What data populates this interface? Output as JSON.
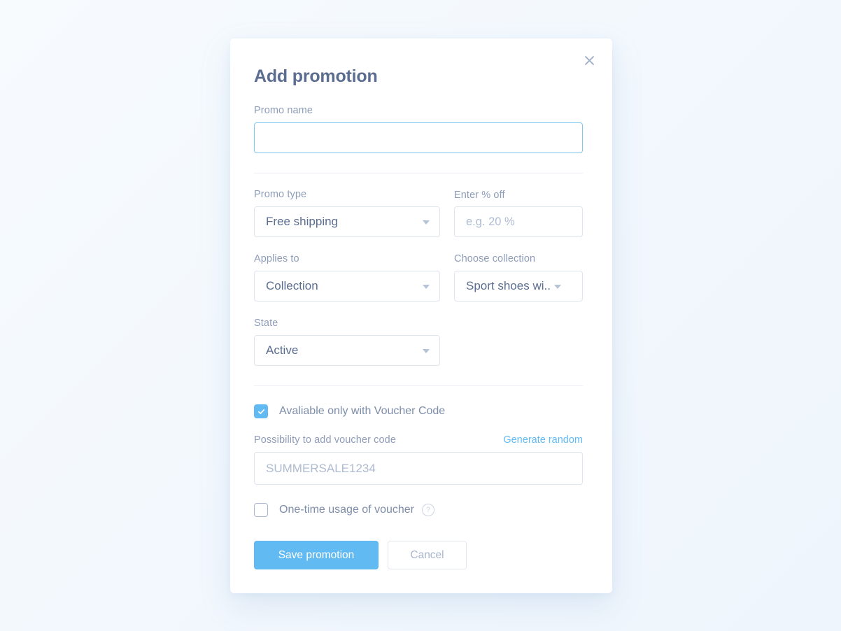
{
  "dialog": {
    "title": "Add promotion",
    "close_icon": "close-icon"
  },
  "fields": {
    "promo_name": {
      "label": "Promo name",
      "value": "",
      "placeholder": ""
    },
    "promo_type": {
      "label": "Promo type",
      "value": "Free shipping",
      "options": [
        "Free shipping"
      ]
    },
    "percent_off": {
      "label": "Enter % off",
      "value": "",
      "placeholder": "e.g. 20 %"
    },
    "applies_to": {
      "label": "Applies to",
      "value": "Collection",
      "options": [
        "Collection"
      ]
    },
    "choose_collection": {
      "label": "Choose collection",
      "value": "Sport shoes wi...",
      "options": [
        "Sport shoes wi..."
      ]
    },
    "state": {
      "label": "State",
      "value": "Active",
      "options": [
        "Active"
      ]
    }
  },
  "voucher": {
    "available_checkbox": {
      "label": "Avaliable only with Voucher Code",
      "checked": true
    },
    "code_label": "Possibility to add voucher code",
    "generate_link": "Generate random",
    "code_value": "",
    "code_placeholder": "SUMMERSALE1234",
    "one_time_checkbox": {
      "label": "One-time usage of voucher",
      "checked": false,
      "help_icon": "question-mark-icon",
      "help_glyph": "?"
    }
  },
  "actions": {
    "save_label": "Save promotion",
    "cancel_label": "Cancel"
  },
  "colors": {
    "accent": "#62baf3",
    "title": "#5b6d90",
    "label": "#8e9cb8",
    "page_background": "#f3f8fd",
    "card_background": "#ffffff",
    "border": "#dfe5ef",
    "focus_border": "#7ec8f2"
  }
}
